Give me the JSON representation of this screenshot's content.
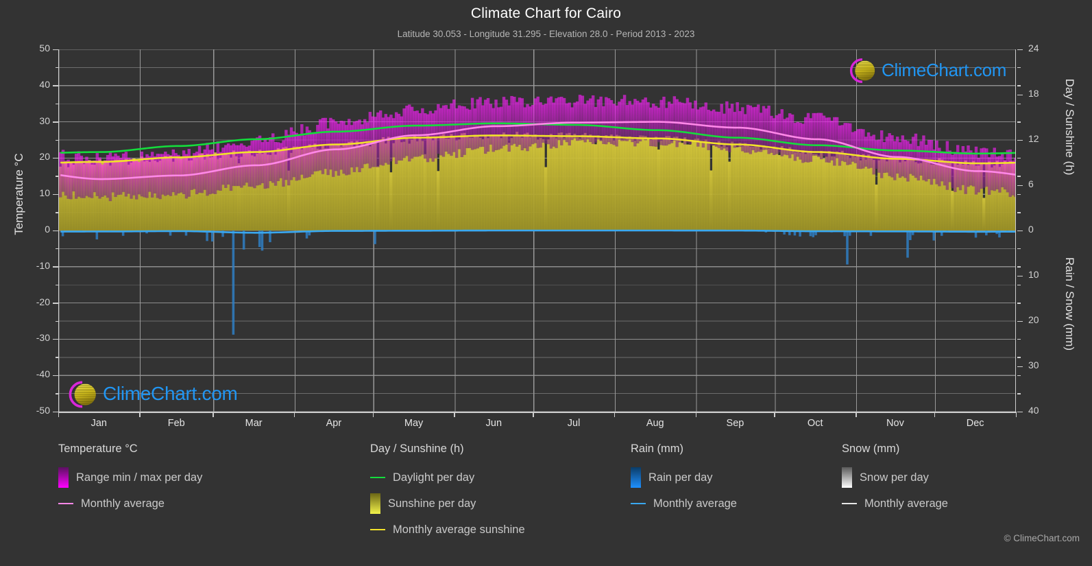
{
  "header": {
    "title": "Climate Chart for Cairo",
    "subtitle": "Latitude 30.053 - Longitude 31.295 - Elevation 28.0 - Period 2013 - 2023"
  },
  "watermark": {
    "text": "ClimeChart.com",
    "logo_arc_color": "#d926d9",
    "logo_sphere_color": "#d6c423",
    "text_color": "#2196f3"
  },
  "footer": {
    "copyright": "© ClimeChart.com"
  },
  "legend": {
    "columns": [
      {
        "heading": "Temperature °C",
        "items": [
          {
            "label": "Range min / max per day",
            "marker": "gradient-box",
            "color": "#ff00ff",
            "color2": "#5a1060"
          },
          {
            "label": "Monthly average",
            "marker": "line",
            "color": "#ff88e8"
          }
        ]
      },
      {
        "heading": "Day / Sunshine (h)",
        "items": [
          {
            "label": "Daylight per day",
            "marker": "line",
            "color": "#14dd3c"
          },
          {
            "label": "Sunshine per day",
            "marker": "gradient-box",
            "color": "#f2f24a",
            "color2": "#6b6615"
          },
          {
            "label": "Monthly average sunshine",
            "marker": "line",
            "color": "#f2e22a"
          }
        ]
      },
      {
        "heading": "Rain (mm)",
        "items": [
          {
            "label": "Rain per day",
            "marker": "gradient-box",
            "color": "#1e90ff",
            "color2": "#0b3c66"
          },
          {
            "label": "Monthly average",
            "marker": "line",
            "color": "#3aa8f0"
          }
        ]
      },
      {
        "heading": "Snow (mm)",
        "items": [
          {
            "label": "Snow per day",
            "marker": "gradient-box",
            "color": "#ffffff",
            "color2": "#5a5a5a"
          },
          {
            "label": "Monthly average",
            "marker": "line",
            "color": "#e8e8e8"
          }
        ]
      }
    ]
  },
  "chart_data": {
    "type": "area",
    "title": "Climate Chart for Cairo",
    "subtitle": "Latitude 30.053 - Longitude 31.295 - Elevation 28.0 - Period 2013 - 2023",
    "xlabel": "",
    "grid": true,
    "legend_position": "bottom",
    "x_tick_labels": [
      "Jan",
      "Feb",
      "Mar",
      "Apr",
      "May",
      "Jun",
      "Jul",
      "Aug",
      "Sep",
      "Oct",
      "Nov",
      "Dec"
    ],
    "axes": {
      "left": {
        "label": "Temperature °C",
        "min": -50,
        "max": 50,
        "step": 10,
        "minor_step": 5,
        "ticks": [
          50,
          40,
          30,
          20,
          10,
          0,
          -10,
          -20,
          -30,
          -40,
          -50
        ]
      },
      "right_top": {
        "label": "Day / Sunshine (h)",
        "min": 0,
        "max": 24,
        "step": 6,
        "ticks": [
          24,
          18,
          12,
          6,
          0
        ],
        "note": "maps 0h at temperature 0 °C to 24h at temperature 50 °C"
      },
      "right_bottom": {
        "label": "Rain / Snow (mm)",
        "min": 0,
        "max": 40,
        "step": 10,
        "ticks": [
          0,
          10,
          20,
          30,
          40
        ],
        "note": "increases downward from temperature 0 °C to -50 °C"
      }
    },
    "series": [
      {
        "name": "Daylight per day",
        "unit": "h",
        "color": "#14dd3c",
        "type": "line",
        "monthly_values": [
          10.4,
          11.2,
          12.1,
          13.1,
          13.9,
          14.2,
          14.0,
          13.3,
          12.3,
          11.3,
          10.6,
          10.2
        ]
      },
      {
        "name": "Monthly average sunshine",
        "unit": "h",
        "color": "#f2e22a",
        "type": "line",
        "monthly_values": [
          9.1,
          9.7,
          10.4,
          11.4,
          12.3,
          12.6,
          12.5,
          12.2,
          11.4,
          10.4,
          9.5,
          8.9
        ]
      },
      {
        "name": "Sunshine per day",
        "unit": "h",
        "color": "#b3a52a",
        "type": "bars",
        "monthly_values": [
          9.0,
          9.6,
          10.3,
          11.3,
          12.2,
          12.6,
          12.5,
          12.1,
          11.3,
          10.3,
          9.4,
          8.8
        ]
      },
      {
        "name": "Monthly average temperature",
        "unit": "°C",
        "color": "#ff88e8",
        "type": "line",
        "monthly_values": [
          14.2,
          15.2,
          18.0,
          22.4,
          26.3,
          28.8,
          29.8,
          30.0,
          28.4,
          25.2,
          20.3,
          16.4
        ]
      },
      {
        "name": "Range min per day",
        "unit": "°C",
        "color": "#c020c0",
        "type": "band-low",
        "monthly_values": [
          9.3,
          10.0,
          12.3,
          16.1,
          19.8,
          22.6,
          24.2,
          24.4,
          22.6,
          19.6,
          15.0,
          11.1
        ]
      },
      {
        "name": "Range max per day",
        "unit": "°C",
        "color": "#ff00ff",
        "type": "band-high",
        "monthly_values": [
          19.7,
          21.2,
          24.6,
          29.5,
          33.3,
          35.4,
          35.6,
          35.5,
          33.6,
          30.6,
          25.6,
          21.4
        ]
      },
      {
        "name": "Rain per day",
        "unit": "mm",
        "color": "#1e90ff",
        "type": "bars-down",
        "monthly_values": [
          0.25,
          0.15,
          0.55,
          0.1,
          0.05,
          0.0,
          0.0,
          0.0,
          0.02,
          0.18,
          0.22,
          0.3
        ],
        "max_daily_spike": 23.0
      },
      {
        "name": "Rain monthly average",
        "unit": "mm",
        "color": "#3aa8f0",
        "type": "line",
        "monthly_values": [
          0.25,
          0.15,
          0.25,
          0.1,
          0.05,
          0.0,
          0.0,
          0.0,
          0.02,
          0.18,
          0.22,
          0.3
        ]
      },
      {
        "name": "Snow per day",
        "unit": "mm",
        "color": "#ffffff",
        "type": "bars-down",
        "monthly_values": [
          0,
          0,
          0,
          0,
          0,
          0,
          0,
          0,
          0,
          0,
          0,
          0
        ]
      }
    ]
  }
}
